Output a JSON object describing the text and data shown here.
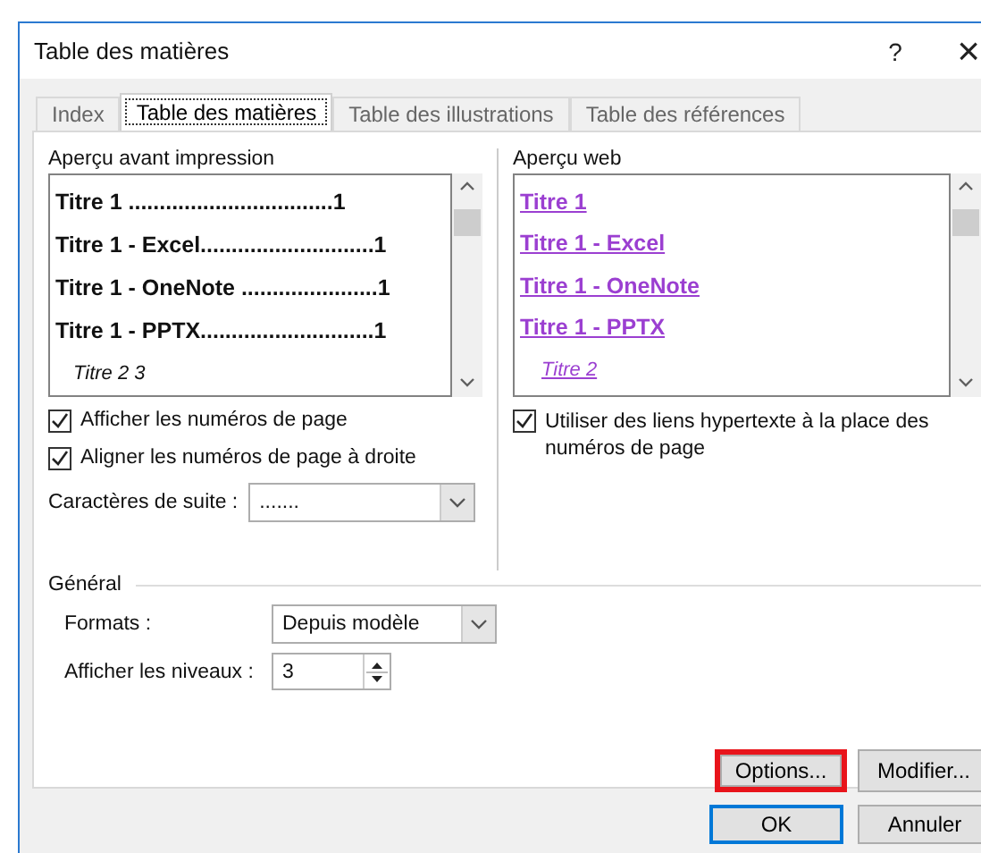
{
  "window": {
    "title": "Table des matières",
    "help": "?",
    "close": "×"
  },
  "tabs": [
    {
      "label": "Index",
      "selected": false
    },
    {
      "label": "Table des matières",
      "selected": true
    },
    {
      "label": "Table des illustrations",
      "selected": false
    },
    {
      "label": "Table des références",
      "selected": false
    }
  ],
  "print_preview": {
    "label": "Aperçu avant impression",
    "entries": [
      {
        "kind": "heading1",
        "text": "Titre 1 .................................1"
      },
      {
        "kind": "heading1",
        "text": "Titre 1 - Excel............................1"
      },
      {
        "kind": "heading1",
        "text": "Titre 1 - OneNote ......................1"
      },
      {
        "kind": "heading1",
        "text": "Titre 1 - PPTX............................1"
      },
      {
        "kind": "heading2",
        "text": "Titre 2 3"
      }
    ]
  },
  "web_preview": {
    "label": "Aperçu web",
    "entries": [
      {
        "kind": "heading1",
        "text": "Titre 1"
      },
      {
        "kind": "heading1",
        "text": "Titre 1 - Excel"
      },
      {
        "kind": "heading1",
        "text": "Titre 1 - OneNote"
      },
      {
        "kind": "heading1",
        "text": "Titre 1 - PPTX"
      },
      {
        "kind": "heading2",
        "text": "Titre 2"
      }
    ]
  },
  "left_options": [
    {
      "label": "Afficher les numéros de page",
      "checked": true
    },
    {
      "label": "Aligner les numéros de page à droite",
      "checked": true
    }
  ],
  "tab_leader": {
    "label": "Caractères de suite :",
    "value": "......."
  },
  "right_options": [
    {
      "label": "Utiliser des liens hypertexte à la place des numéros de page",
      "checked": true
    }
  ],
  "general": {
    "title": "Général",
    "formats_label": "Formats :",
    "formats_value": "Depuis modèle",
    "levels_label": "Afficher les niveaux :",
    "levels_value": "3"
  },
  "panel_buttons": [
    {
      "label": "Options...",
      "highlighted": true
    },
    {
      "label": "Modifier...",
      "highlighted": false
    }
  ],
  "buttons": [
    {
      "label": "OK",
      "default": true
    },
    {
      "label": "Annuler",
      "default": false
    }
  ]
}
